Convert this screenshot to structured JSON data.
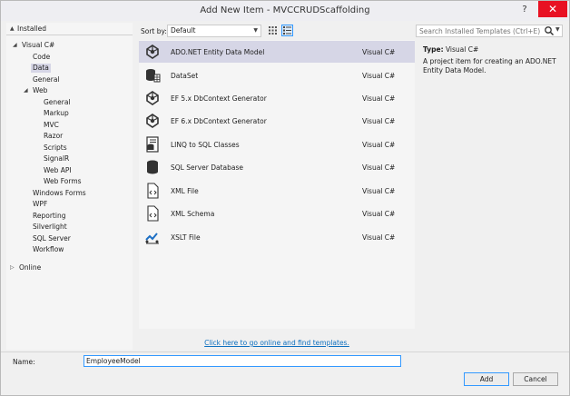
{
  "window": {
    "title": "Add New Item - MVCCRUDScaffolding",
    "help": "?",
    "close": "✕"
  },
  "tree": {
    "installed": "Installed",
    "visual_csharp": "Visual C#",
    "code": "Code",
    "data": "Data",
    "general": "General",
    "web": "Web",
    "web_general": "General",
    "markup": "Markup",
    "mvc": "MVC",
    "razor": "Razor",
    "scripts": "Scripts",
    "signalr": "SignalR",
    "webapi": "Web API",
    "webforms": "Web Forms",
    "windows_forms": "Windows Forms",
    "wpf": "WPF",
    "reporting": "Reporting",
    "silverlight": "Silverlight",
    "sql_server": "SQL Server",
    "workflow": "Workflow",
    "online": "Online"
  },
  "toolbar": {
    "sort_label": "Sort by:",
    "sort_value": "Default"
  },
  "items": [
    {
      "name": "ADO.NET Entity Data Model",
      "lang": "Visual C#",
      "icon": "entity-model-icon"
    },
    {
      "name": "DataSet",
      "lang": "Visual C#",
      "icon": "dataset-icon"
    },
    {
      "name": "EF 5.x DbContext Generator",
      "lang": "Visual C#",
      "icon": "dbcontext-generator-icon"
    },
    {
      "name": "EF 6.x DbContext Generator",
      "lang": "Visual C#",
      "icon": "dbcontext-generator-icon"
    },
    {
      "name": "LINQ to SQL Classes",
      "lang": "Visual C#",
      "icon": "linq-to-sql-icon"
    },
    {
      "name": "SQL Server Database",
      "lang": "Visual C#",
      "icon": "database-icon"
    },
    {
      "name": "XML File",
      "lang": "Visual C#",
      "icon": "xml-file-icon"
    },
    {
      "name": "XML Schema",
      "lang": "Visual C#",
      "icon": "xml-schema-icon"
    },
    {
      "name": "XSLT File",
      "lang": "Visual C#",
      "icon": "xslt-file-icon"
    }
  ],
  "online_link": "Click here to go online and find templates.",
  "search": {
    "placeholder": "Search Installed Templates (Ctrl+E)"
  },
  "details": {
    "type_label": "Type:",
    "type_value": "Visual C#",
    "description": "A project item for creating an ADO.NET Entity Data Model."
  },
  "form": {
    "name_label": "Name:",
    "name_value": "EmployeeModel"
  },
  "buttons": {
    "add": "Add",
    "cancel": "Cancel"
  },
  "colors": {
    "accent": "#3399ff",
    "selection": "#d6d6e6",
    "close": "#e81123",
    "link": "#0e70c0"
  }
}
